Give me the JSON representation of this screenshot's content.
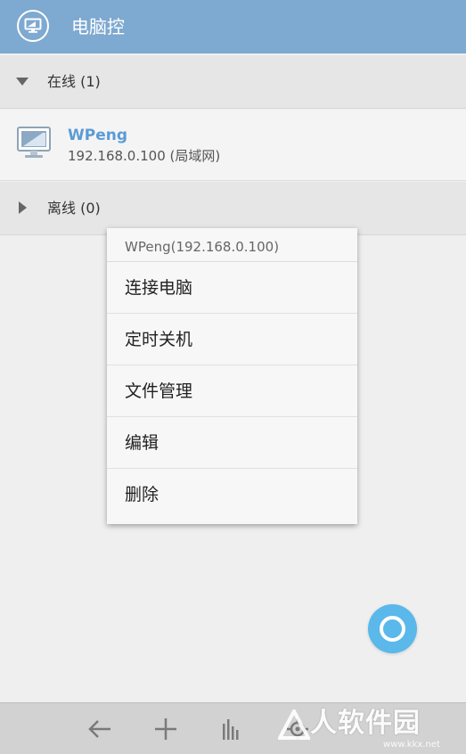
{
  "header": {
    "title": "电脑控",
    "icon": "monitor-icon",
    "background": "#7ea9d0"
  },
  "groups": {
    "online": {
      "label": "在线 (1)",
      "expanded": true
    },
    "offline": {
      "label": "离线 (0)",
      "expanded": false
    }
  },
  "devices": [
    {
      "name": "WPeng",
      "address": "192.168.0.100 (局域网)",
      "icon": "monitor-icon"
    }
  ],
  "context_menu": {
    "title": "WPeng(192.168.0.100)",
    "items": [
      {
        "label": "连接电脑"
      },
      {
        "label": "定时关机"
      },
      {
        "label": "文件管理"
      },
      {
        "label": "编辑"
      },
      {
        "label": "删除"
      }
    ]
  },
  "fab": {
    "icon": "ring-icon",
    "color": "#5ab8ea"
  },
  "bottom_bar": {
    "buttons": [
      {
        "icon": "back-arrow-icon"
      },
      {
        "icon": "plus-icon"
      },
      {
        "icon": "bar-chart-icon"
      },
      {
        "icon": "settings-icon"
      }
    ]
  },
  "watermark": {
    "text": "人软件园",
    "url": "www.kkx.net"
  },
  "colors": {
    "accent": "#5b9bd5",
    "fab": "#5ab8ea",
    "header": "#7ea9d0"
  }
}
